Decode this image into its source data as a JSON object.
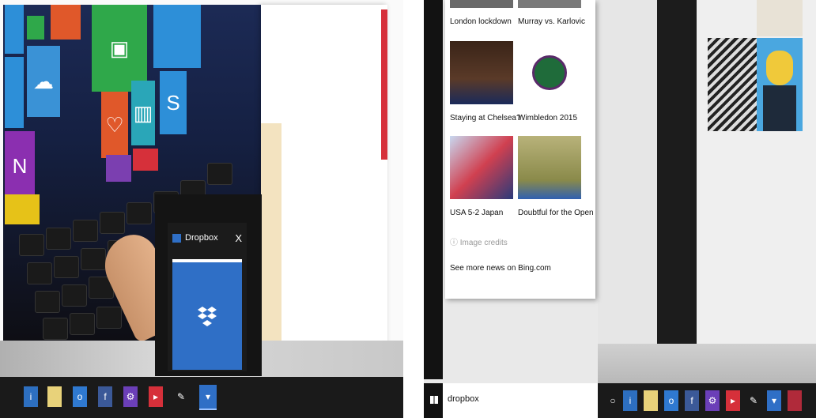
{
  "left": {
    "dropbox_window": {
      "title": "Dropbox",
      "close": "X"
    }
  },
  "right": {
    "news": {
      "items": [
        {
          "caption": "London lockdown"
        },
        {
          "caption": "Murray vs. Karlovic"
        },
        {
          "caption": "Staying at Chelsea?"
        },
        {
          "caption": "Wimbledon 2015"
        },
        {
          "caption": "USA 5-2 Japan"
        },
        {
          "caption": "Doubtful for the Open"
        }
      ],
      "image_credits": "Image credits",
      "see_more": "See more news on Bing.com"
    },
    "search": {
      "value": "dropbox"
    }
  },
  "colors": {
    "taskbar": "#1a1a1a",
    "dropbox_blue": "#2f6fc6",
    "tile_green": "#2fa84a",
    "tile_blue": "#2d8fd8",
    "tile_orange": "#e0582a",
    "tile_purple": "#7b3fb0"
  }
}
